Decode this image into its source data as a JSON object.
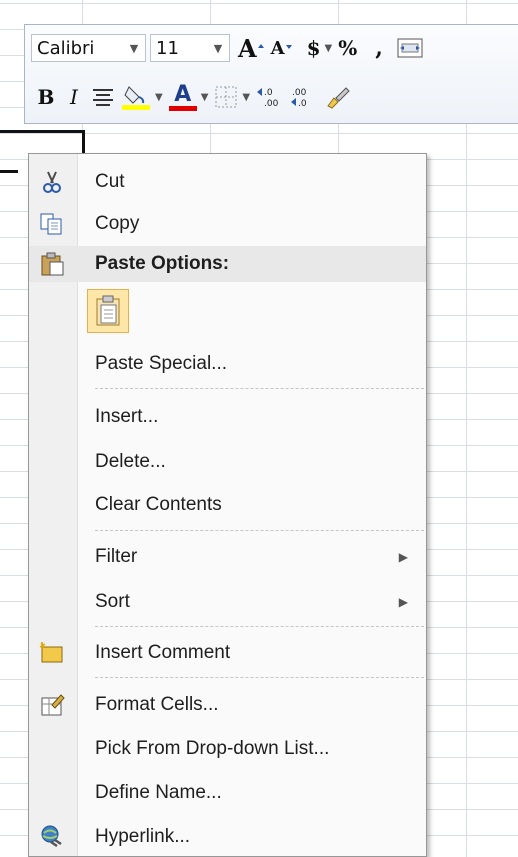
{
  "toolbar": {
    "font_name": "Calibri",
    "font_size": "11",
    "grow_font": "A",
    "shrink_font": "A",
    "currency": "$",
    "percent": "%",
    "comma": ",",
    "bold": "B",
    "italic": "I",
    "font_color_letter": "A"
  },
  "menu": {
    "cut": "Cut",
    "copy": "Copy",
    "paste_options": "Paste Options:",
    "paste_special": "Paste Special...",
    "insert": "Insert...",
    "delete": "Delete...",
    "clear_contents": "Clear Contents",
    "filter": "Filter",
    "sort": "Sort",
    "insert_comment": "Insert Comment",
    "format_cells": "Format Cells...",
    "pick_list": "Pick From Drop-down List...",
    "define_name": "Define Name...",
    "hyperlink": "Hyperlink..."
  },
  "colors": {
    "fill_highlight": "#ffff00",
    "font_color": "#e00000",
    "accent_border": "#e3b24c"
  }
}
